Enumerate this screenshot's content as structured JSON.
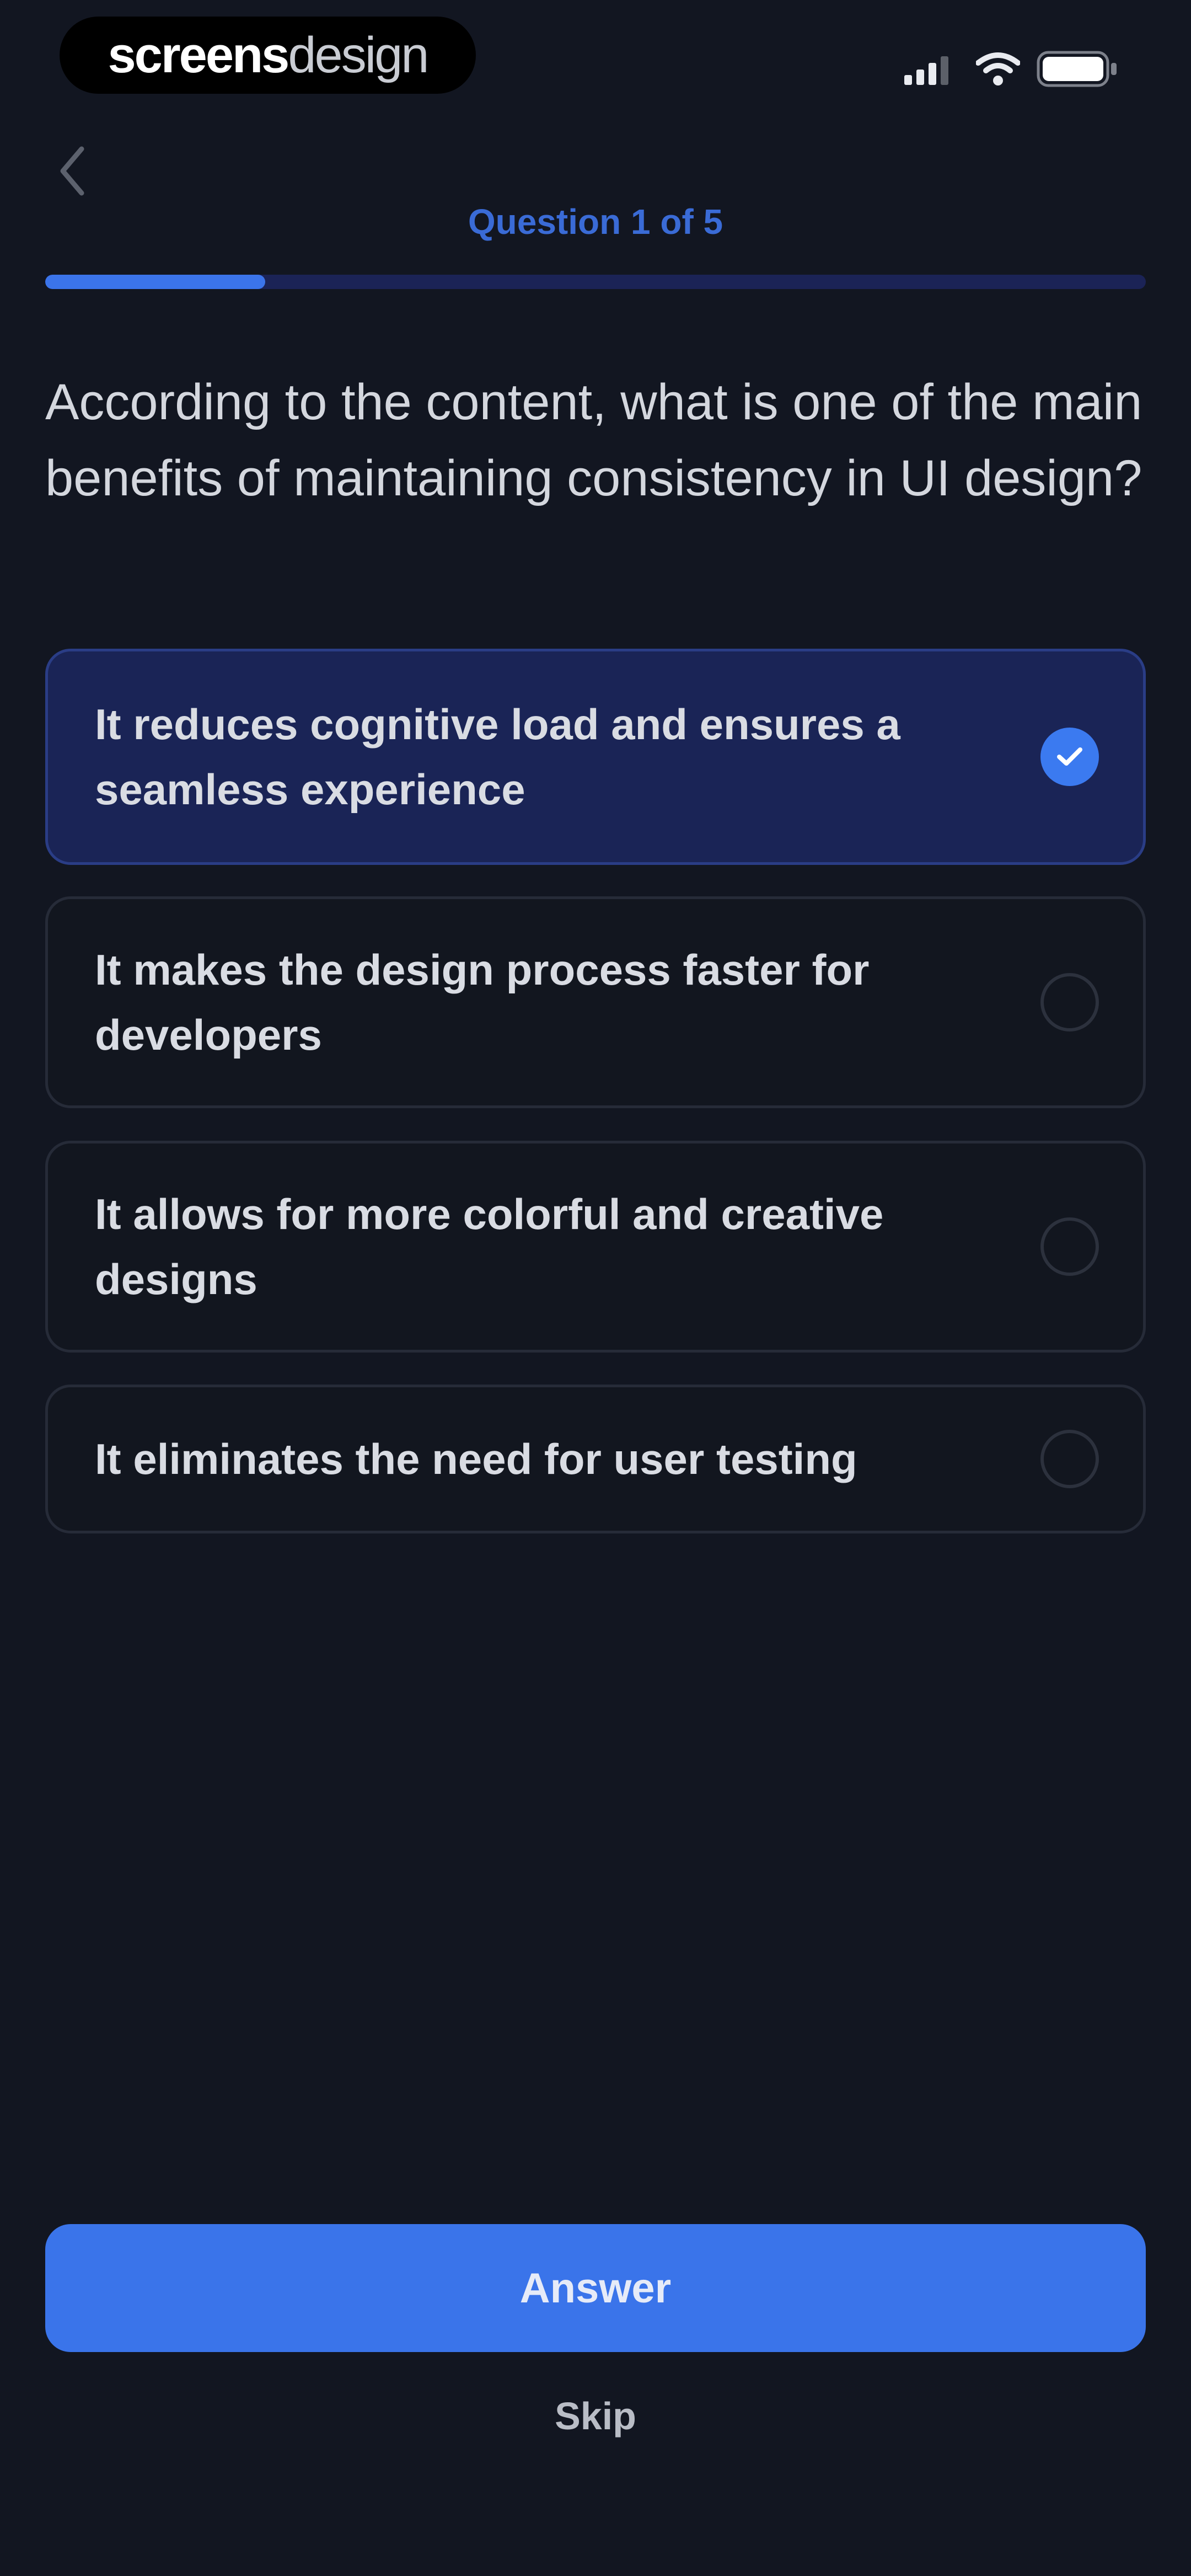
{
  "status_bar": {
    "brand_bold": "screens",
    "brand_light": "design",
    "icons": [
      "cellular-signal-icon",
      "wifi-icon",
      "battery-icon"
    ]
  },
  "header": {
    "back_icon": "chevron-left-icon",
    "counter": "Question 1 of 5",
    "progress": 0.2
  },
  "question": "According to the content, what is one of the main benefits of maintaining consistency in UI design?",
  "options": [
    {
      "label": "It reduces cognitive load and ensures a seamless experience",
      "selected": true
    },
    {
      "label": "It makes the design process faster for developers",
      "selected": false
    },
    {
      "label": "It allows for more colorful and creative designs",
      "selected": false
    },
    {
      "label": "It eliminates the need for user testing",
      "selected": false
    }
  ],
  "actions": {
    "answer_label": "Answer",
    "skip_label": "Skip"
  },
  "colors": {
    "background": "#121621",
    "accent": "#3a74ea",
    "selected_option_bg": "#1a2456",
    "progress_track": "#1b2356"
  }
}
